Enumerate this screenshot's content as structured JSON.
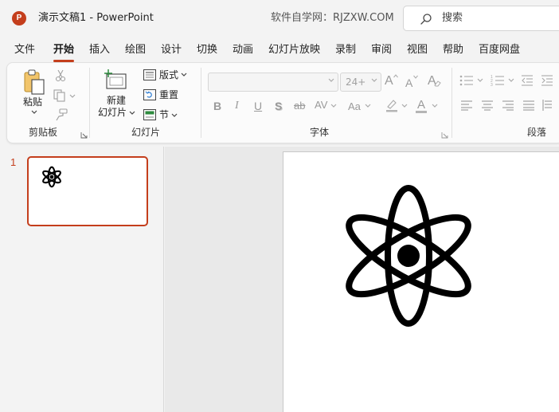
{
  "titlebar": {
    "logo_letter": "P",
    "title": "演示文稿1  -  PowerPoint",
    "watermark": "软件自学网：RJZXW.COM",
    "search_placeholder": "搜索"
  },
  "tabs": [
    {
      "label": "文件"
    },
    {
      "label": "开始",
      "active": true
    },
    {
      "label": "插入"
    },
    {
      "label": "绘图"
    },
    {
      "label": "设计"
    },
    {
      "label": "切换"
    },
    {
      "label": "动画"
    },
    {
      "label": "幻灯片放映"
    },
    {
      "label": "录制"
    },
    {
      "label": "审阅"
    },
    {
      "label": "视图"
    },
    {
      "label": "帮助"
    },
    {
      "label": "百度网盘"
    }
  ],
  "ribbon": {
    "clipboard": {
      "group_label": "剪贴板",
      "paste_label": "粘贴"
    },
    "slides": {
      "group_label": "幻灯片",
      "new_slide_line1": "新建",
      "new_slide_line2": "幻灯片",
      "layout_label": "版式",
      "reset_label": "重置",
      "section_label": "节"
    },
    "font": {
      "group_label": "字体",
      "font_name_value": "",
      "font_size_value": "24+",
      "bold": "B",
      "italic": "I",
      "underline": "U",
      "shadow": "S",
      "strike": "ab",
      "spacing": "AV",
      "case": "Aa",
      "color_letter": "A",
      "grow": "A",
      "shrink": "A",
      "clear": "A"
    },
    "paragraph": {
      "group_label": "段落"
    }
  },
  "slides_pane": {
    "slide_number": "1"
  },
  "colors": {
    "accent": "#c43e1c"
  }
}
